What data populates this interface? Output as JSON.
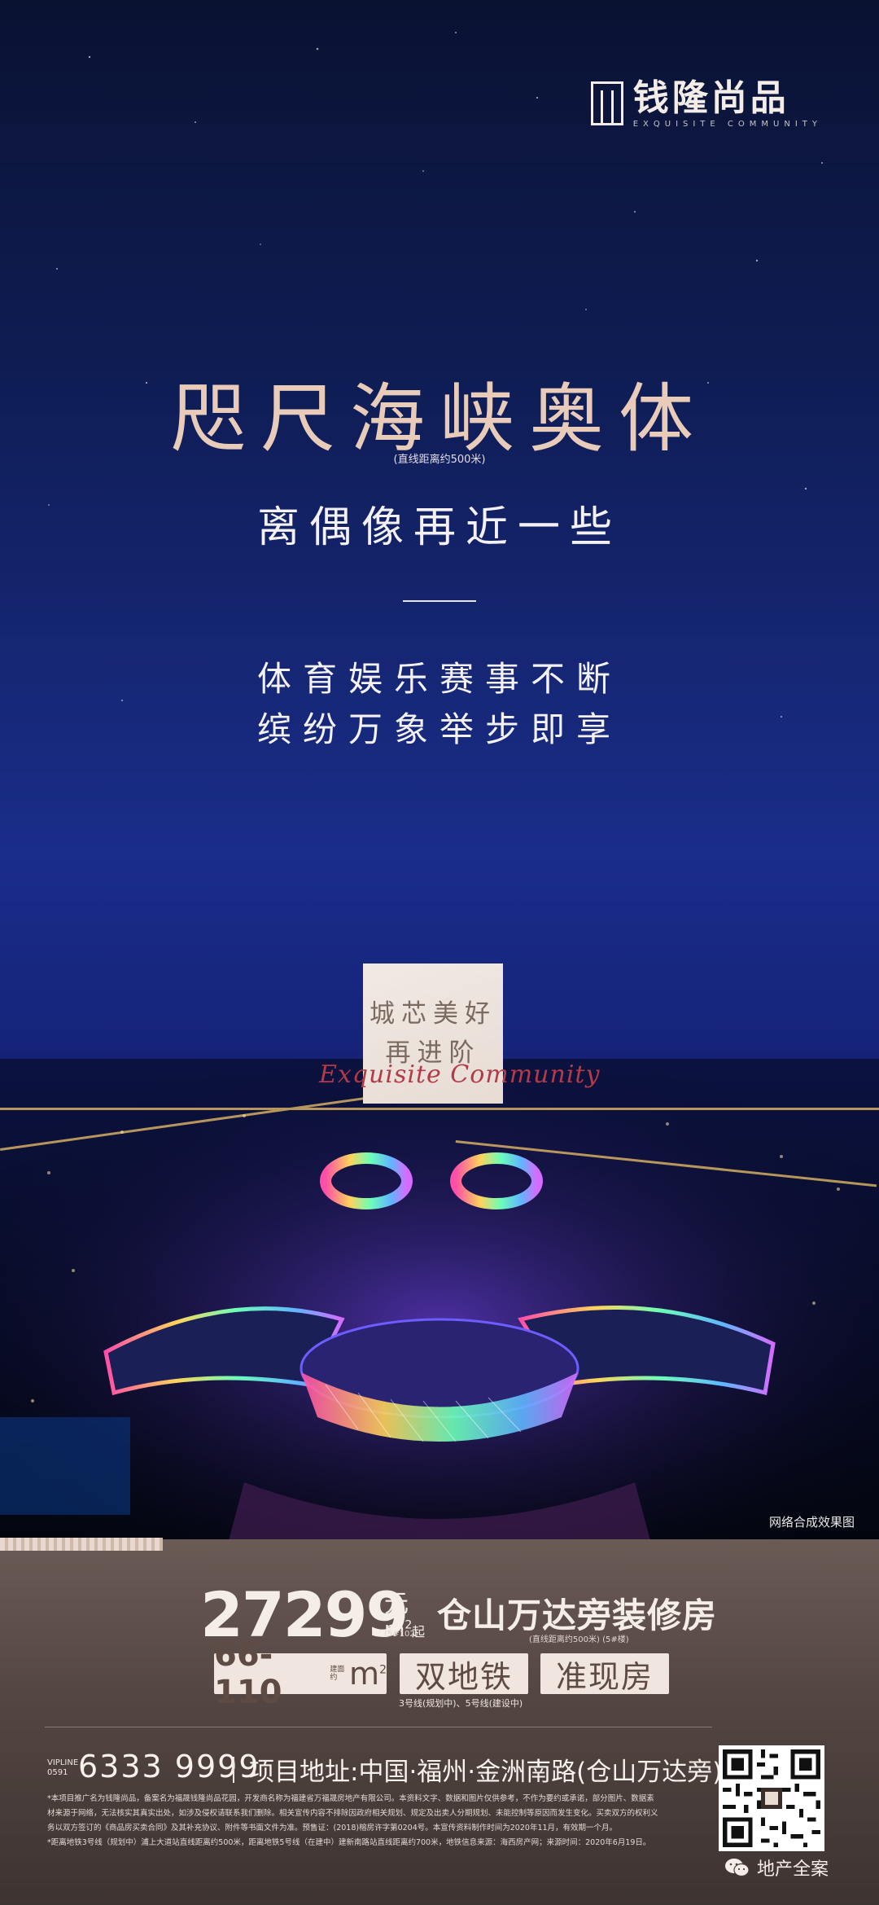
{
  "logo": {
    "name": "钱隆尚品",
    "tagline": "EXQUISITE COMMUNITY"
  },
  "hero": {
    "title": "咫尺海峡奥体",
    "distance_note": "(直线距离约500米)",
    "subtitle": "离偶像再近一些",
    "line1": "体育娱乐赛事不断",
    "line2": "缤纷万象举步即享"
  },
  "badge": {
    "line1": "城芯美好",
    "line2": "再进阶",
    "script": "Exquisite Community"
  },
  "image_caption": "网络合成效果图",
  "offer": {
    "price": "27299",
    "unit_yuan": "元",
    "unit_m": "m",
    "unit_sup": "2",
    "unit_note": "(5#102)",
    "unit_qi": "起",
    "headline": "仓山万达旁装修房",
    "headline_note": "(直线距离约500米)  (5#楼)"
  },
  "tags": {
    "area_range": "66-110",
    "area_small": "建面约",
    "area_unit": "m",
    "area_sup": "2",
    "metro": "双地铁",
    "ready": "准现房"
  },
  "metro_note": "3号线(规划中)、5号线(建设中)",
  "contact": {
    "vip_label": "VIPLINE",
    "vip_code": "0591",
    "phone": "6333 9999",
    "address": "项目地址:中国·福州·金洲南路(仓山万达旁)"
  },
  "disclaimer": [
    "*本项目推广名为钱隆尚品，备案名为福晟钱隆尚品花园，开发商名称为福建省万福晟房地产有限公司。本资料文字、数据和图片仅供参考，不作为要约或承诺，部分图片、数据素",
    "材来源于网络，无法核实其真实出处，如涉及侵权请联系我们删除。相关宣传内容不排除因政府相关规划、规定及出卖人分期规划、未能控制等原因而发生变化。买卖双方的权利义",
    "务以双方签订的《商品房买卖合同》及其补充协议、附件等书面文件为准。预售证：(2018)榕房许字第0204号。本宣传资料制作时间为2020年11月，有效期一个月。",
    "*距离地铁3号线（规划中）浦上大道站直线距离约500米，距离地铁5号线（在建中）建新南路站直线距离约700米，地铁信息来源：海西房产网；来源时间：2020年6月19日。"
  ],
  "watermark": "地产全案",
  "icons": {
    "qr": "qr-code-icon",
    "wechat": "wechat-icon",
    "logo": "building-logo-icon"
  }
}
